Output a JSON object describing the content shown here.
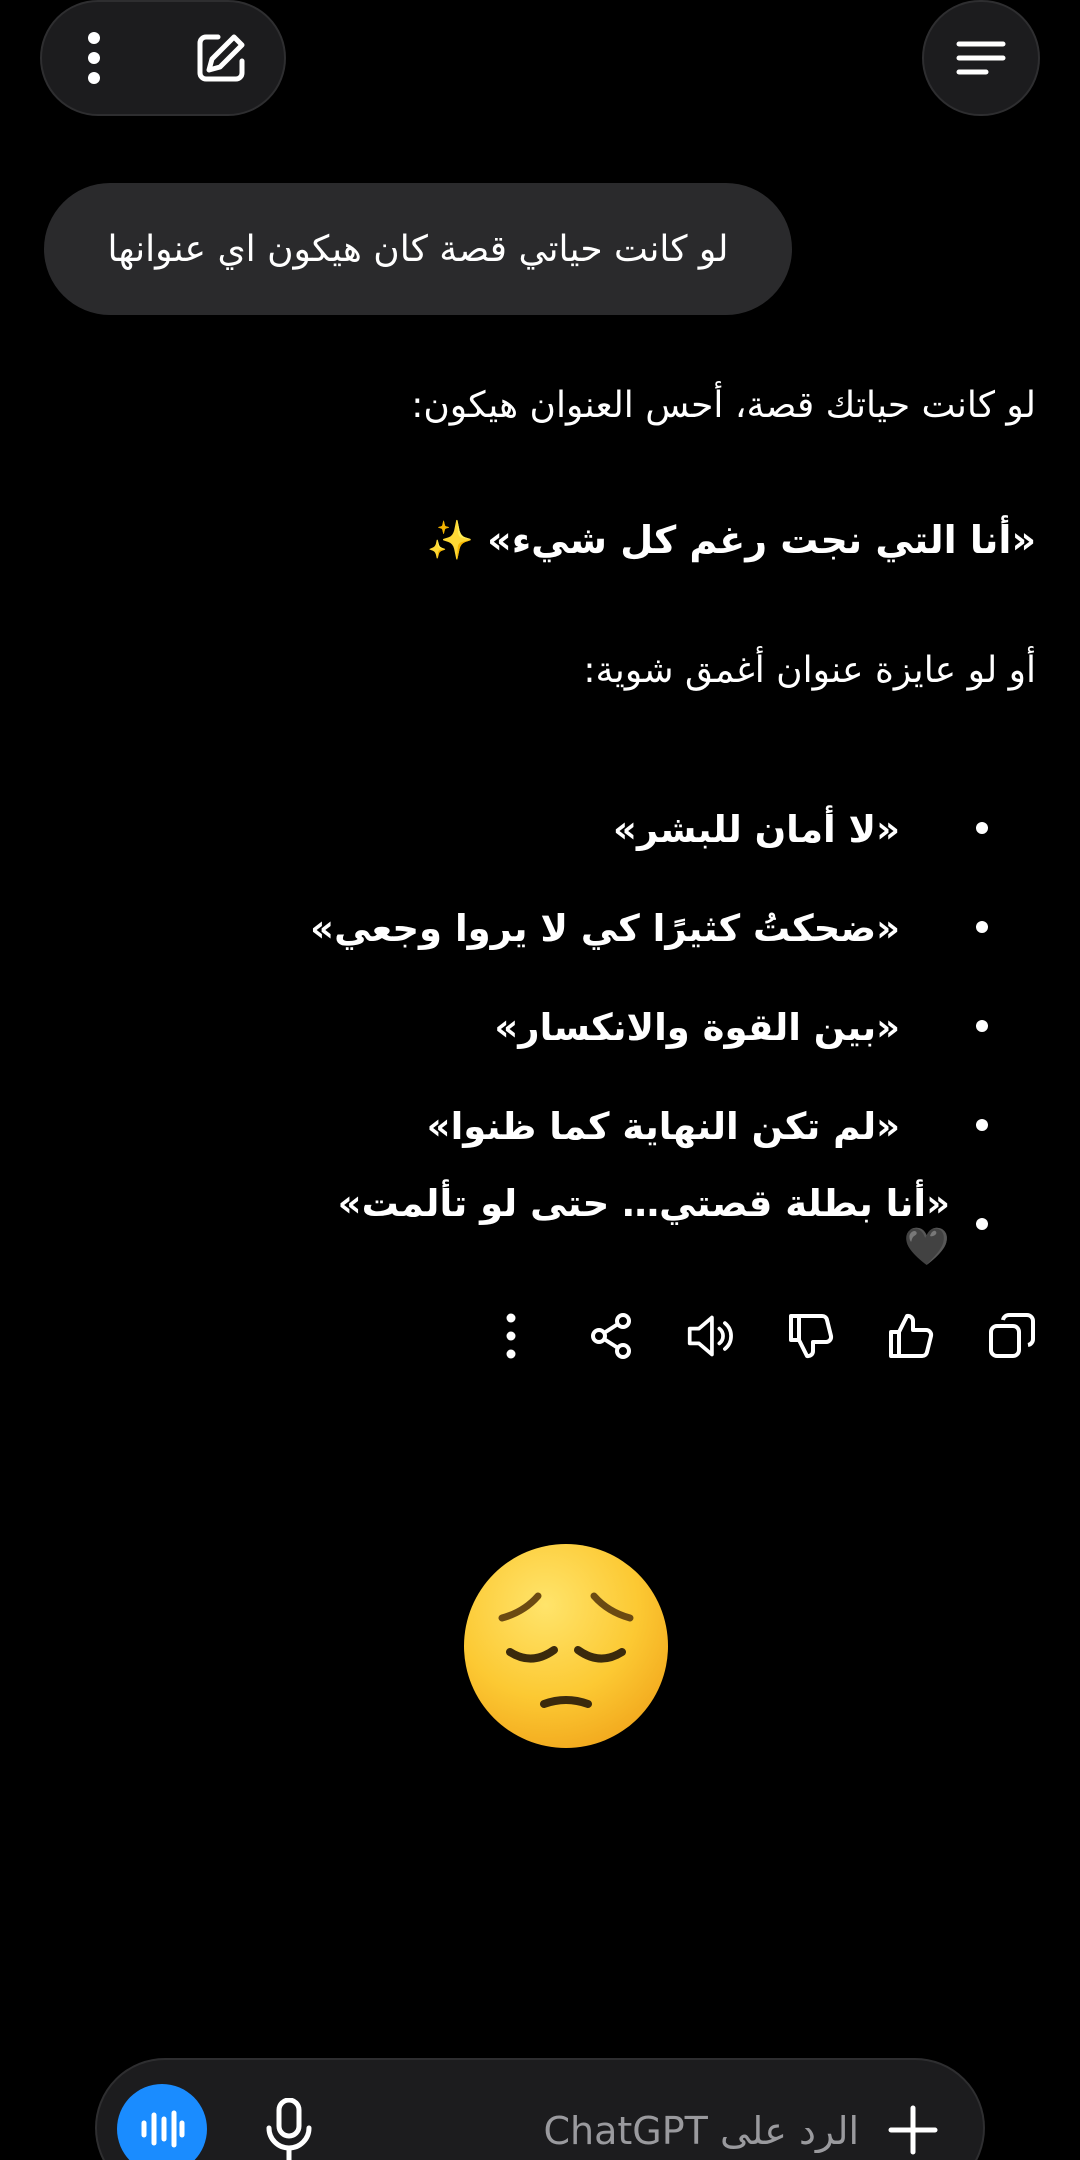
{
  "header": {
    "more_icon": "more-vertical-icon",
    "new_chat_icon": "edit-icon",
    "menu_icon": "menu-icon"
  },
  "conversation": {
    "user_message": "لو كانت حياتي قصة كان هيكون اي عنوانها",
    "assistant": {
      "intro": "لو كانت حياتك قصة، أحس العنوان هيكون:",
      "main_title": "«أنا التي نجت رغم كل شيء» ✨",
      "alt_intro": "أو لو عايزة عنوان أغمق شوية:",
      "options": [
        "«لا أمان للبشر»",
        "«ضحكتُ كثيرًا كي لا يروا وجعي»",
        "«بين القوة والانكسار»",
        "«لم تكن النهاية كما ظنوا»",
        "«أنا بطلة قصتي… حتى لو تألمت» 🖤"
      ]
    },
    "actions": [
      "copy-icon",
      "thumbs-up-icon",
      "thumbs-down-icon",
      "read-aloud-icon",
      "share-icon",
      "more-vertical-icon"
    ]
  },
  "reaction_emoji": "pensive-face",
  "composer": {
    "placeholder": "الرد على ChatGPT",
    "colors": {
      "voice_button": "#1a8cff"
    }
  }
}
